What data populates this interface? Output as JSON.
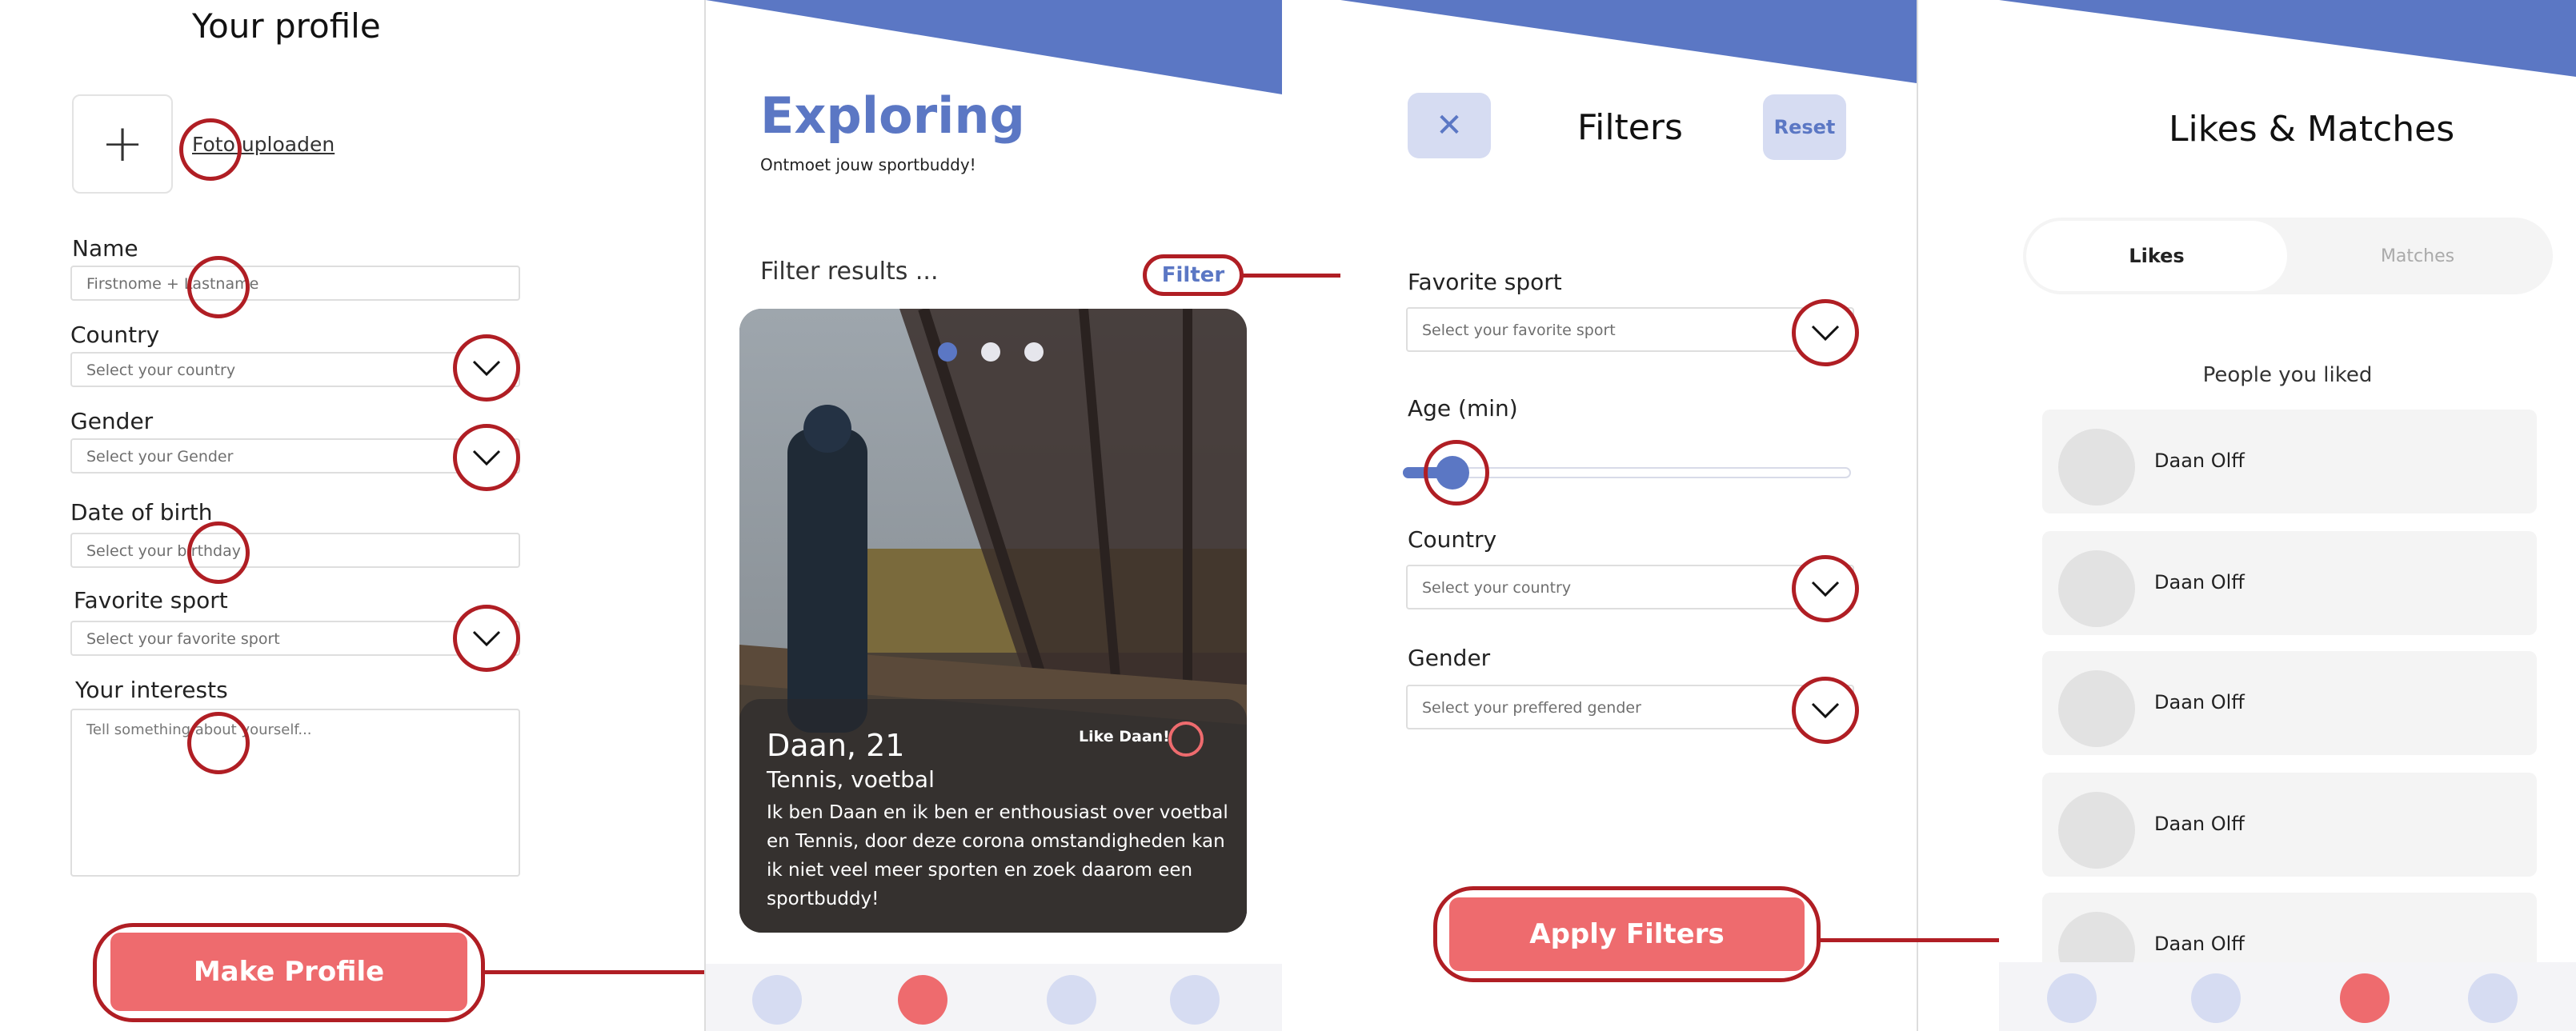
{
  "colors": {
    "accent_blue": "#5b77c4",
    "accent_red": "#ee6b6e",
    "annotation_red": "#b01e24",
    "nav_dot_light": "#d6dcf2"
  },
  "profile": {
    "title": "Your profile",
    "upload_icon": "plus-icon",
    "upload_label": "Foto uploaden",
    "name_label": "Name",
    "name_placeholder": "Firstnome + Lastname",
    "country_label": "Country",
    "country_placeholder": "Select your country",
    "gender_label": "Gender",
    "gender_placeholder": "Select your Gender",
    "dob_label": "Date of birth",
    "dob_placeholder": "Select your birthday",
    "sport_label": "Favorite sport",
    "sport_placeholder": "Select your favorite sport",
    "interests_label": "Your interests",
    "interests_placeholder": "Tell something about yourself...",
    "submit_label": "Make Profile"
  },
  "explore": {
    "title": "Exploring",
    "subtitle": "Ontmoet jouw sportbuddy!",
    "filter_results_label": "Filter results ...",
    "filter_button": "Filter",
    "card": {
      "name": "Daan, 21",
      "sports": "Tennis, voetbal",
      "bio": "Ik ben Daan en ik ben er enthousiast over voetbal en Tennis, door deze corona omstandigheden kan ik niet veel meer sporten en zoek daarom een sportbuddy!",
      "like_label": "Like Daan!",
      "page_count": 3,
      "active_page": 1
    }
  },
  "filters": {
    "title": "Filters",
    "close_icon": "close-icon",
    "reset_label": "Reset",
    "sport_label": "Favorite sport",
    "sport_placeholder": "Select your favorite sport",
    "age_label": "Age (min)",
    "age_slider_fraction": 0.1,
    "country_label": "Country",
    "country_placeholder": "Select your country",
    "gender_label": "Gender",
    "gender_placeholder": "Select your preffered gender",
    "apply_label": "Apply Filters"
  },
  "likes": {
    "title": "Likes & Matches",
    "tab_likes": "Likes",
    "tab_matches": "Matches",
    "section_label": "People you liked",
    "people": [
      "Daan Olff",
      "Daan Olff",
      "Daan Olff",
      "Daan Olff",
      "Daan Olff"
    ]
  }
}
